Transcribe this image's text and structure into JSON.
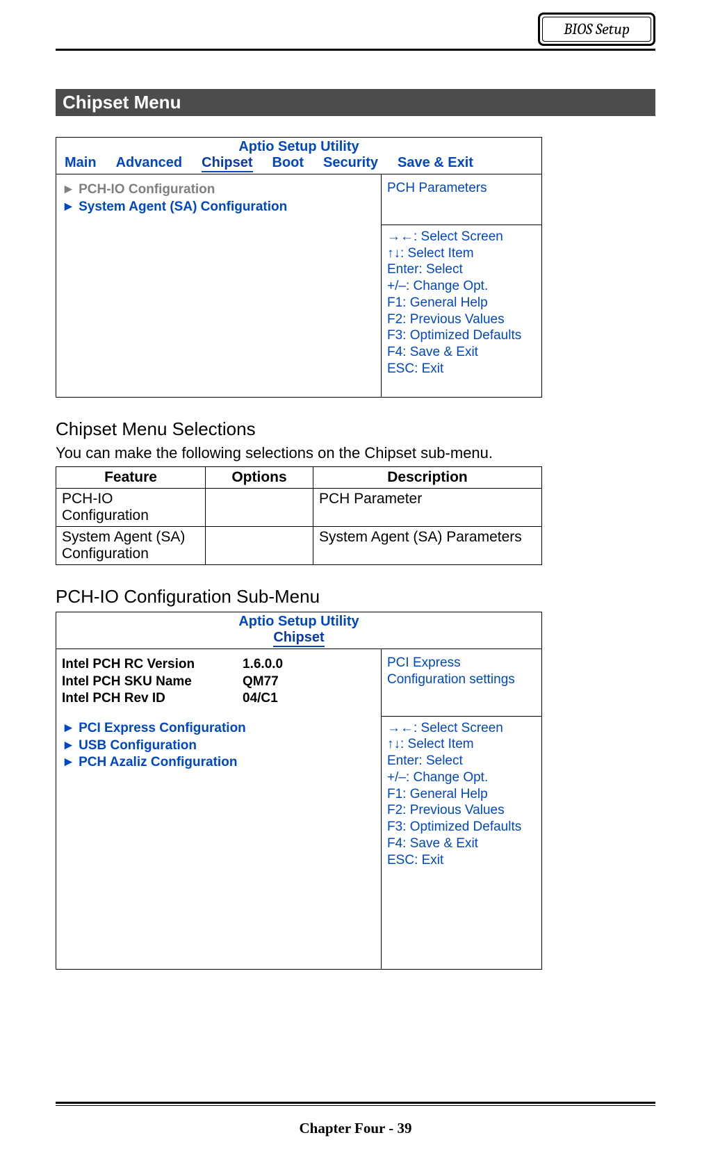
{
  "header": {
    "badge": "BIOS Setup"
  },
  "section_title": "Chipset Menu",
  "aptio1": {
    "title": "Aptio Setup Utility",
    "tabs": {
      "main": "Main",
      "advanced": "Advanced",
      "chipset": "Chipset",
      "boot": "Boot",
      "security": "Security",
      "saveexit": "Save & Exit"
    },
    "items": {
      "pchio": "► PCH-IO Configuration",
      "sa": "► System Agent (SA) Configuration"
    },
    "help": "PCH Parameters",
    "keys": {
      "k1": "→←: Select Screen",
      "k2": "↑↓: Select Item",
      "k3": "Enter: Select",
      "k4": "+/–: Change Opt.",
      "k5": "F1: General Help",
      "k6": "F2: Previous Values",
      "k7": "F3: Optimized Defaults",
      "k8": "F4: Save & Exit",
      "k9": "ESC: Exit"
    }
  },
  "selections": {
    "heading": "Chipset Menu Selections",
    "intro": "You can make the following selections on the Chipset sub-menu.",
    "th": {
      "feature": "Feature",
      "options": "Options",
      "description": "Description"
    },
    "rows": {
      "r1": {
        "feature": "PCH-IO Configuration",
        "options": "",
        "description": "PCH Parameter"
      },
      "r2": {
        "feature": "System Agent (SA) Configuration",
        "options": "",
        "description": "System Agent (SA) Parameters"
      }
    }
  },
  "pchio_sub": {
    "heading": "PCH-IO Configuration Sub-Menu",
    "title": "Aptio Setup Utility",
    "tab": "Chipset",
    "info": {
      "l1": "Intel PCH RC Version",
      "v1": "1.6.0.0",
      "l2": "Intel PCH SKU Name",
      "v2": "QM77",
      "l3": "Intel PCH Rev ID",
      "v3": "04/C1"
    },
    "items": {
      "i1": "► PCI Express Configuration",
      "i2": "► USB Configuration",
      "i3": "► PCH Azaliz Configuration"
    },
    "help": "PCI Express Configuration settings",
    "keys": {
      "k1": "→←: Select Screen",
      "k2": "↑↓: Select Item",
      "k3": "Enter: Select",
      "k4": "+/–: Change Opt.",
      "k5": "F1: General Help",
      "k6": "F2: Previous Values",
      "k7": "F3: Optimized Defaults",
      "k8": "F4: Save & Exit",
      "k9": "ESC: Exit"
    }
  },
  "footer": "Chapter Four - 39"
}
